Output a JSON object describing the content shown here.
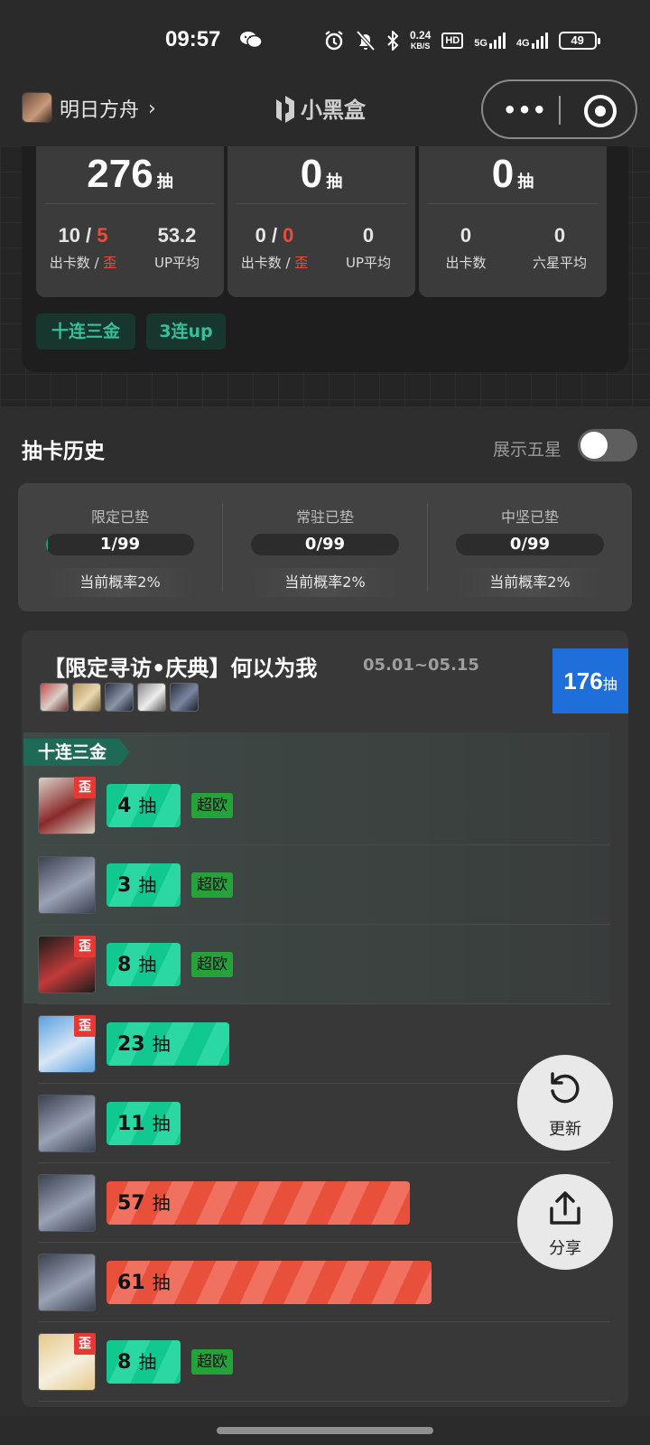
{
  "status_bar": {
    "time": "09:57",
    "net_speed": "0.24",
    "net_unit": "KB/S",
    "hd": "HD",
    "sig1": "5G",
    "sig2": "4G",
    "battery": "49"
  },
  "nav": {
    "app_name": "明日方舟",
    "chevron": "›",
    "logo_text": "小黑盒",
    "more": "•••"
  },
  "summary": [
    {
      "big": "276",
      "unit": "抽",
      "v1a": "10",
      "v1b": "5",
      "l1a": "出卡数",
      "l1b": "歪",
      "v2": "53.2",
      "l2": "UP平均"
    },
    {
      "big": "0",
      "unit": "抽",
      "v1a": "0",
      "v1b": "0",
      "l1a": "出卡数",
      "l1b": "歪",
      "v2": "0",
      "l2": "UP平均"
    },
    {
      "big": "0",
      "unit": "抽",
      "v1": "0",
      "l1": "出卡数",
      "v2": "0",
      "l2": "六星平均"
    }
  ],
  "tags": [
    "十连三金",
    "3连up"
  ],
  "history": {
    "title": "抽卡历史",
    "toggle_label": "展示五星",
    "toggle_on": false
  },
  "pity": [
    {
      "title": "限定已垫",
      "value": "1/99",
      "progress": 0.01,
      "rate": "当前概率2%"
    },
    {
      "title": "常驻已垫",
      "value": "0/99",
      "progress": 0,
      "rate": "当前概率2%"
    },
    {
      "title": "中坚已垫",
      "value": "0/99",
      "progress": 0,
      "rate": "当前概率2%"
    }
  ],
  "banner": {
    "title": "【限定寻访•庆典】何以为我",
    "date": "05.01~05.15",
    "total": "176",
    "total_unit": "抽",
    "group_label": "十连三金",
    "pulls": [
      {
        "count": "4",
        "unit": "抽",
        "off": true,
        "badge": "歪",
        "lucky": "超欧",
        "color": "green",
        "avatar": [
          "#d9d2c8",
          "#8a2a2a"
        ]
      },
      {
        "count": "3",
        "unit": "抽",
        "off": false,
        "badge": "",
        "lucky": "超欧",
        "color": "green",
        "avatar": [
          "#3a4250",
          "#9aa3b5"
        ]
      },
      {
        "count": "8",
        "unit": "抽",
        "off": true,
        "badge": "歪",
        "lucky": "超欧",
        "color": "green",
        "avatar": [
          "#1c1c1c",
          "#c23a3a"
        ]
      },
      {
        "count": "23",
        "unit": "抽",
        "off": true,
        "badge": "歪",
        "lucky": "",
        "color": "green",
        "avatar": [
          "#5aa0e0",
          "#d8e6f5"
        ]
      },
      {
        "count": "11",
        "unit": "抽",
        "off": false,
        "badge": "",
        "lucky": "",
        "color": "green",
        "avatar": [
          "#3a4250",
          "#9aa3b5"
        ]
      },
      {
        "count": "57",
        "unit": "抽",
        "off": false,
        "badge": "",
        "lucky": "",
        "color": "red",
        "avatar": [
          "#3a4250",
          "#9aa3b5"
        ]
      },
      {
        "count": "61",
        "unit": "抽",
        "off": false,
        "badge": "",
        "lucky": "",
        "color": "red",
        "avatar": [
          "#3a4250",
          "#9aa3b5"
        ]
      },
      {
        "count": "8",
        "unit": "抽",
        "off": true,
        "badge": "歪",
        "lucky": "超欧",
        "color": "green",
        "avatar": [
          "#e6c98a",
          "#f5efe0"
        ]
      }
    ]
  },
  "fab": {
    "refresh": "更新",
    "share": "分享"
  }
}
